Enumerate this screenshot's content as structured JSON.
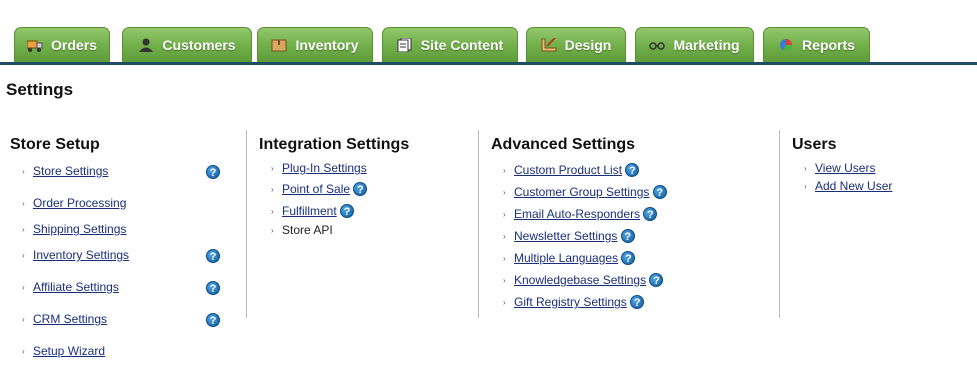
{
  "tabs": [
    {
      "label": "Orders",
      "icon": "truck-icon"
    },
    {
      "label": "Customers",
      "icon": "person-icon"
    },
    {
      "label": "Inventory",
      "icon": "box-icon"
    },
    {
      "label": "Site Content",
      "icon": "pages-icon"
    },
    {
      "label": "Design",
      "icon": "pencil-ruler-icon"
    },
    {
      "label": "Marketing",
      "icon": "glasses-icon"
    },
    {
      "label": "Reports",
      "icon": "pie-chart-icon"
    }
  ],
  "page_title": "Settings",
  "help_glyph": "?",
  "arrow_glyph": "›",
  "store_setup": {
    "title": "Store Setup",
    "items": [
      "Store Settings",
      "Order Processing",
      "Shipping Settings",
      "Inventory Settings",
      "Affiliate Settings",
      "CRM Settings",
      "Setup Wizard"
    ]
  },
  "integration": {
    "title": "Integration Settings",
    "items": [
      "Plug-In Settings",
      "Point of Sale",
      "Fulfillment",
      "Store API"
    ]
  },
  "advanced": {
    "title": "Advanced Settings",
    "items": [
      "Custom Product List",
      "Customer Group Settings",
      "Email Auto-Responders",
      "Newsletter Settings",
      "Multiple Languages",
      "Knowledgebase Settings",
      "Gift Registry Settings"
    ]
  },
  "users": {
    "title": "Users",
    "items": [
      "View Users",
      "Add New User"
    ]
  },
  "colors": {
    "tab_green": "#6fae48",
    "tab_line": "#1f4d66",
    "link": "#1a2f7a"
  }
}
